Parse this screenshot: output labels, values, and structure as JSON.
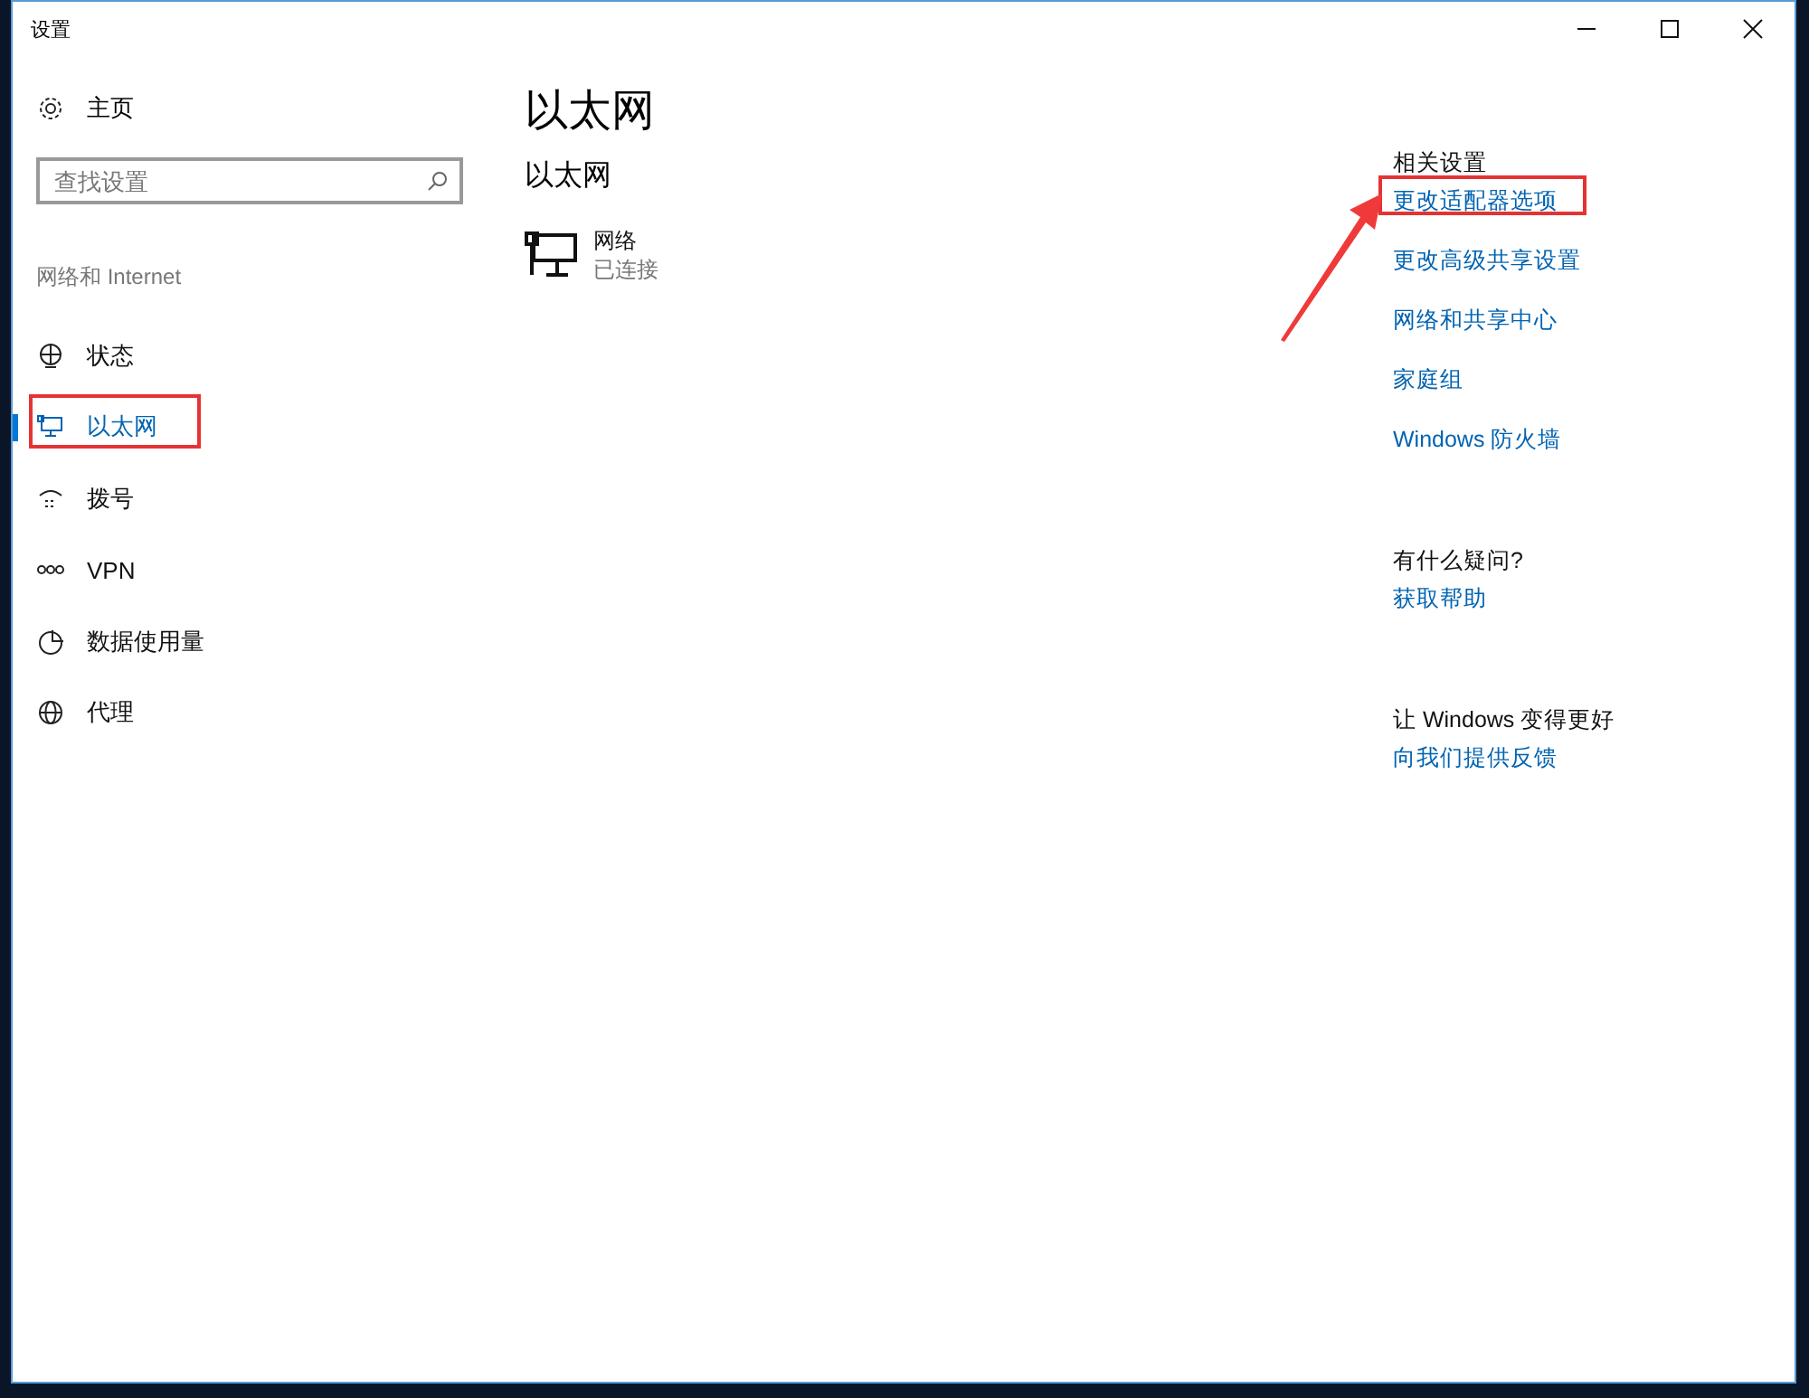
{
  "window": {
    "title": "设置"
  },
  "sidebar": {
    "home": "主页",
    "search": {
      "placeholder": "查找设置"
    },
    "category": "网络和 Internet",
    "items": [
      {
        "label": "状态",
        "kind": "status",
        "selected": false,
        "marked": false
      },
      {
        "label": "以太网",
        "kind": "ethernet",
        "selected": true,
        "marked": true
      },
      {
        "label": "拨号",
        "kind": "dialup",
        "selected": false,
        "marked": false
      },
      {
        "label": "VPN",
        "kind": "vpn",
        "selected": false,
        "marked": false
      },
      {
        "label": "数据使用量",
        "kind": "data",
        "selected": false,
        "marked": false
      },
      {
        "label": "代理",
        "kind": "proxy",
        "selected": false,
        "marked": false
      }
    ]
  },
  "main": {
    "title": "以太网",
    "subtitle": "以太网",
    "network": {
      "name": "网络",
      "status": "已连接"
    }
  },
  "related": {
    "heading": "相关设置",
    "links": [
      {
        "label": "更改适配器选项",
        "marked": true
      },
      {
        "label": "更改高级共享设置",
        "marked": false
      },
      {
        "label": "网络和共享中心",
        "marked": false
      },
      {
        "label": "家庭组",
        "marked": false
      },
      {
        "label": "Windows 防火墙",
        "marked": false
      }
    ]
  },
  "help": {
    "heading": "有什么疑问?",
    "link": "获取帮助"
  },
  "feedback": {
    "heading": "让 Windows 变得更好",
    "link": "向我们提供反馈"
  }
}
